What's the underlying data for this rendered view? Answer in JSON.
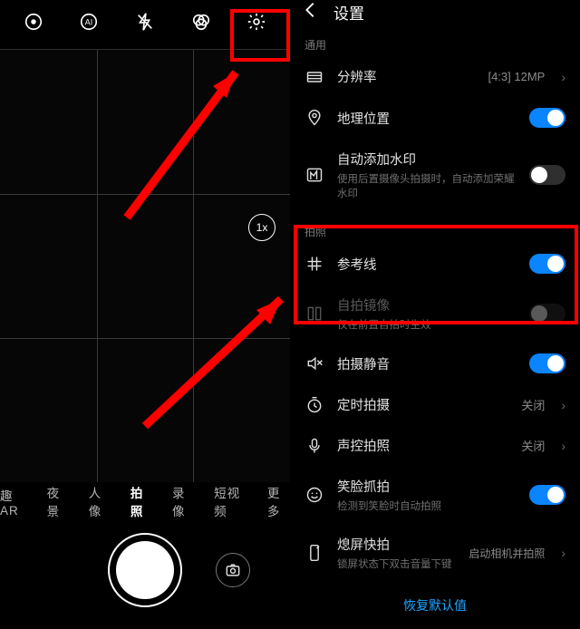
{
  "camera": {
    "topIcons": [
      "effect",
      "ai",
      "flash-off",
      "filter",
      "settings"
    ],
    "zoom": "1x",
    "modes": [
      {
        "label": "趣AR",
        "active": false
      },
      {
        "label": "夜景",
        "active": false
      },
      {
        "label": "人像",
        "active": false
      },
      {
        "label": "拍照",
        "active": true
      },
      {
        "label": "录像",
        "active": false
      },
      {
        "label": "短视频",
        "active": false
      },
      {
        "label": "更多",
        "active": false
      }
    ]
  },
  "settings": {
    "title": "设置",
    "sections": {
      "general_label": "通用",
      "photo_label": "拍照"
    },
    "rows": {
      "resolution": {
        "label": "分辨率",
        "value": "[4:3] 12MP"
      },
      "location": {
        "label": "地理位置",
        "on": true
      },
      "watermark": {
        "label": "自动添加水印",
        "sub": "使用后置摄像头拍摄时，自动添加荣耀水印",
        "on": false
      },
      "gridlines": {
        "label": "参考线",
        "on": true
      },
      "mirror": {
        "label": "自拍镜像",
        "sub": "仅在前置自拍时生效",
        "on": false
      },
      "mute": {
        "label": "拍摄静音",
        "on": true
      },
      "timer": {
        "label": "定时拍摄",
        "value": "关闭"
      },
      "voice": {
        "label": "声控拍照",
        "value": "关闭"
      },
      "smile": {
        "label": "笑脸抓拍",
        "sub": "检测到笑脸时自动拍照",
        "on": true
      },
      "screenoff": {
        "label": "熄屏快拍",
        "sub": "锁屏状态下双击音量下键",
        "value": "启动相机并拍照"
      }
    },
    "restore": "恢复默认值"
  }
}
